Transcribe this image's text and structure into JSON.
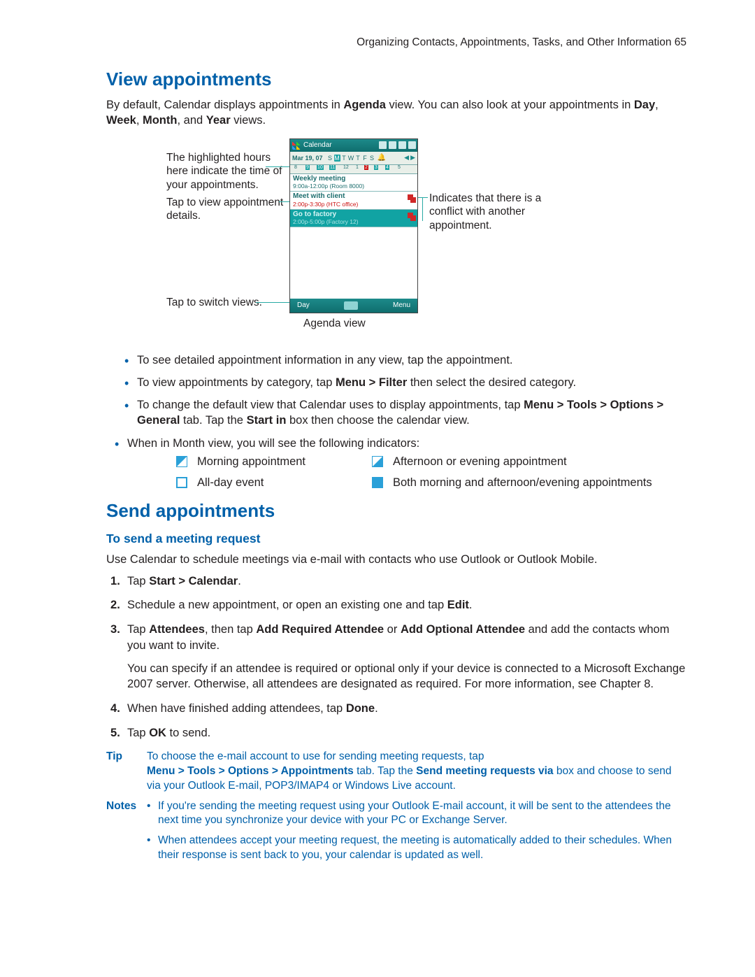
{
  "header": {
    "running": "Organizing Contacts, Appointments, Tasks, and Other Information  65"
  },
  "section1": {
    "title": "View appointments",
    "intro_pre": "By default, Calendar displays appointments in ",
    "intro_b1": "Agenda",
    "intro_mid1": " view. You can also look at your appointments in ",
    "intro_b2": "Day",
    "intro_comma": ", ",
    "intro_b3": "Week",
    "intro_comma2": ", ",
    "intro_b4": "Month",
    "intro_and": ", and ",
    "intro_b5": "Year",
    "intro_post": " views.",
    "callout_left1": "The highlighted hours here indicate the time of your appointments.",
    "callout_left2": "Tap to view appointment details.",
    "callout_left3": "Tap to switch views.",
    "callout_right": "Indicates that there is a conflict with another appointment.",
    "fig_caption": "Agenda view",
    "bullet1": "To see detailed appointment information in any view, tap the appointment.",
    "bullet2_pre": "To view appointments by category, tap ",
    "bullet2_b": "Menu > Filter",
    "bullet2_post": " then select the desired category.",
    "bullet3_pre": "To change the default view that Calendar uses to display appointments, tap ",
    "bullet3_b1": "Menu > Tools > Options > General",
    "bullet3_mid": " tab. Tap the ",
    "bullet3_b2": "Start in",
    "bullet3_post": " box then choose the calendar view.",
    "bullet4": "When in Month view, you will see the following indicators:",
    "legend": {
      "morning": "Morning appointment",
      "afternoon": "Afternoon or evening appointment",
      "allday": "All-day event",
      "both": "Both morning and afternoon/evening appointments"
    }
  },
  "device": {
    "title": "Calendar",
    "date": "Mar 19, 07",
    "days": [
      "S",
      "M",
      "T",
      "W",
      "T",
      "F",
      "S"
    ],
    "ruler": [
      "8",
      "9",
      "10",
      "11",
      "12",
      "1",
      "2",
      "3",
      "4",
      "5"
    ],
    "appt1_title": "Weekly meeting",
    "appt1_sub": "9:00a-12:00p (Room 8000)",
    "appt2_title": "Meet with client",
    "appt2_sub": "2:00p-3:30p (HTC office)",
    "appt3_title": "Go to factory",
    "appt3_sub": "2:00p-5:00p (Factory 12)",
    "soft_left": "Day",
    "soft_right": "Menu"
  },
  "section2": {
    "title": "Send appointments",
    "sub": "To send a meeting request",
    "intro": "Use Calendar to schedule meetings via e-mail with contacts who use Outlook or Outlook Mobile.",
    "step1_pre": "Tap ",
    "step1_b": "Start > Calendar",
    "step1_post": ".",
    "step2_pre": "Schedule a new appointment, or open an existing one and tap ",
    "step2_b": "Edit",
    "step2_post": ".",
    "step3_pre": "Tap ",
    "step3_b1": "Attendees",
    "step3_mid1": ", then tap ",
    "step3_b2": "Add Required Attendee",
    "step3_or": " or ",
    "step3_b3": "Add Optional Attendee",
    "step3_post": " and add the contacts whom you want to invite.",
    "step3_para": "You can specify if an attendee is required or optional only if your device is connected to a Microsoft Exchange 2007 server. Otherwise, all attendees are designated as required. For more information, see Chapter 8.",
    "step4_pre": "When have finished adding attendees, tap ",
    "step4_b": "Done",
    "step4_post": ".",
    "step5_pre": "Tap ",
    "step5_b": "OK",
    "step5_post": " to send.",
    "tip_label": "Tip",
    "tip_l1": "To choose the e-mail account to use for sending meeting requests, tap",
    "tip_b1": "Menu > Tools > Options > Appointments",
    "tip_mid": " tab. Tap the ",
    "tip_b2": "Send meeting requests via",
    "tip_post": " box and choose to send via your Outlook E-mail, POP3/IMAP4 or Windows Live account.",
    "notes_label": "Notes",
    "note1": "If you're sending the meeting request using your Outlook E-mail account, it will be sent to the attendees the next time you synchronize your device with your PC or Exchange Server.",
    "note2": "When attendees accept your meeting request, the meeting is automatically added to their schedules. When their response is sent back to you, your calendar is updated as well."
  }
}
